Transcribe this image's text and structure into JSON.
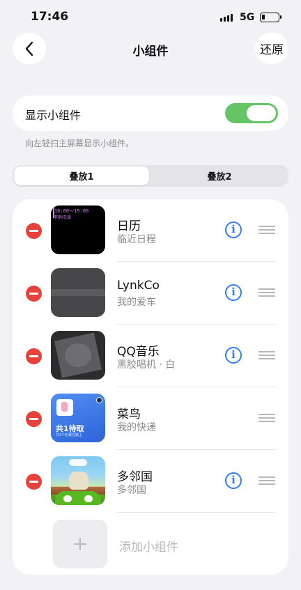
{
  "status_bar": {
    "time": "17:46",
    "network": "5G"
  },
  "nav": {
    "title": "小组件",
    "restore_label": "还原",
    "back_icon": "chevron-left-icon"
  },
  "toggle": {
    "label": "显示小组件",
    "on": true,
    "accent": "#65c466"
  },
  "hint": "向左轻扫主屏幕显示小组件。",
  "segments": {
    "options": [
      "叠放1",
      "叠放2"
    ],
    "selected": 0
  },
  "widgets": [
    {
      "title": "日历",
      "subtitle": "临近日程",
      "has_info": true,
      "thumb": "calendar",
      "thumb_time": "16:00～19:00",
      "thumb_event": "狗狗洗澡"
    },
    {
      "title": "LynkCo",
      "subtitle": "我的爱车",
      "has_info": true,
      "thumb": "lynkco"
    },
    {
      "title": "QQ音乐",
      "subtitle": "黑胶唱机 · 白",
      "has_info": true,
      "thumb": "qqmusic"
    },
    {
      "title": "菜鸟",
      "subtitle": "我的快递",
      "has_info": false,
      "thumb": "cainiao",
      "thumb_big": "共1待取",
      "thumb_small": "共2个包裹在路上"
    },
    {
      "title": "多邻国",
      "subtitle": "多邻国",
      "has_info": true,
      "thumb": "duolingo"
    }
  ],
  "add_widget_label": "添加小组件",
  "colors": {
    "delete": "#e8413a",
    "info": "#2f7cf6",
    "background": "#f2f2f6"
  }
}
